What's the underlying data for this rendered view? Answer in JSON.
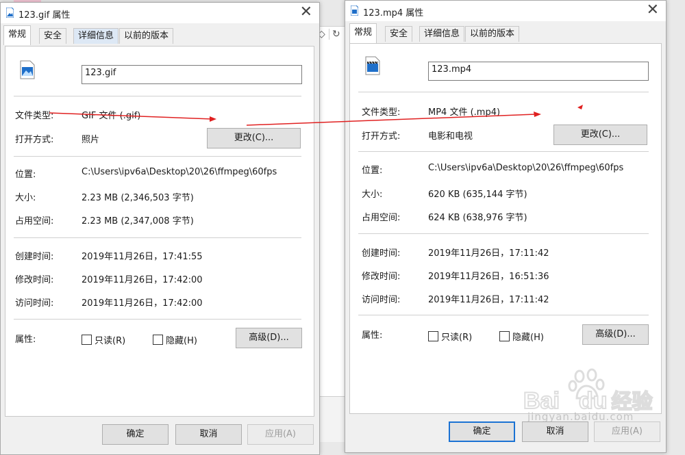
{
  "background": {
    "toolbar_icon": "refresh-icon",
    "toolbar_glyph": "↻"
  },
  "close_glyph": "✕",
  "left": {
    "title": "123.gif 属性",
    "tabs": [
      "常规",
      "安全",
      "详细信息",
      "以前的版本"
    ],
    "filename": "123.gif",
    "icon": "image-file-icon",
    "labels": {
      "type": "文件类型:",
      "open": "打开方式:",
      "location": "位置:",
      "size": "大小:",
      "disk": "占用空间:",
      "created": "创建时间:",
      "modified": "修改时间:",
      "accessed": "访问时间:",
      "attrs": "属性:"
    },
    "values": {
      "type": "GIF 文件 (.gif)",
      "open": "照片",
      "location": "C:\\Users\\ipv6a\\Desktop\\20\\26\\ffmpeg\\60fps",
      "size": "2.23 MB (2,346,503 字节)",
      "disk": "2.23 MB (2,347,008 字节)",
      "created": "2019年11月26日，17:41:55",
      "modified": "2019年11月26日，17:42:00",
      "accessed": "2019年11月26日，17:42:00"
    },
    "buttons": {
      "change": "更改(C)...",
      "advanced": "高级(D)...",
      "ok": "确定",
      "cancel": "取消",
      "apply": "应用(A)"
    },
    "checkboxes": {
      "readonly": "只读(R)",
      "hidden": "隐藏(H)"
    }
  },
  "right": {
    "title": "123.mp4 属性",
    "tabs": [
      "常规",
      "安全",
      "详细信息",
      "以前的版本"
    ],
    "filename": "123.mp4",
    "icon": "video-file-icon",
    "labels": {
      "type": "文件类型:",
      "open": "打开方式:",
      "location": "位置:",
      "size": "大小:",
      "disk": "占用空间:",
      "created": "创建时间:",
      "modified": "修改时间:",
      "accessed": "访问时间:",
      "attrs": "属性:"
    },
    "values": {
      "type": "MP4 文件 (.mp4)",
      "open": "电影和电视",
      "location": "C:\\Users\\ipv6a\\Desktop\\20\\26\\ffmpeg\\60fps",
      "size": "620 KB (635,144 字节)",
      "disk": "624 KB (638,976 字节)",
      "created": "2019年11月26日，17:11:42",
      "modified": "2019年11月26日，16:51:36",
      "accessed": "2019年11月26日，17:11:42"
    },
    "buttons": {
      "change": "更改(C)...",
      "advanced": "高级(D)...",
      "ok": "确定",
      "cancel": "取消",
      "apply": "应用(A)"
    },
    "checkboxes": {
      "readonly": "只读(R)",
      "hidden": "隐藏(H)"
    }
  },
  "watermark": {
    "brand": "Bai",
    "brand2": "du",
    "cn": "经验",
    "url": "jingyan.baidu.com"
  },
  "colors": {
    "arrow": "#e02020",
    "accent": "#1b72d3",
    "icon_blue": "#1f6fc9"
  }
}
